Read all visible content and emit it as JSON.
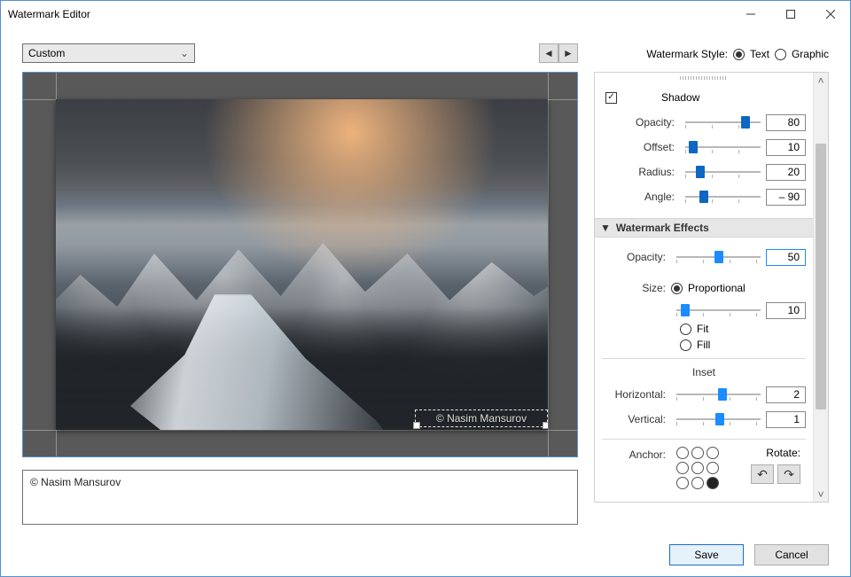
{
  "window": {
    "title": "Watermark Editor"
  },
  "preset": {
    "selected": "Custom"
  },
  "watermark_text_value": "© Nasim Mansurov",
  "watermark_overlay": "© Nasim Mansurov",
  "style_label": "Watermark Style:",
  "style_text": "Text",
  "style_graphic": "Graphic",
  "shadow": {
    "label": "Shadow",
    "opacity_label": "Opacity:",
    "opacity": 80,
    "offset_label": "Offset:",
    "offset": 10,
    "radius_label": "Radius:",
    "radius": 20,
    "angle_label": "Angle:",
    "angle": "– 90"
  },
  "effects": {
    "section": "Watermark Effects",
    "opacity_label": "Opacity:",
    "opacity": 50,
    "size_label": "Size:",
    "size_mode": "Proportional",
    "size_value": 10,
    "fit_label": "Fit",
    "fill_label": "Fill",
    "inset_label": "Inset",
    "horizontal_label": "Horizontal:",
    "horizontal": 2,
    "vertical_label": "Vertical:",
    "vertical": 1,
    "anchor_label": "Anchor:",
    "rotate_label": "Rotate:"
  },
  "footer": {
    "save": "Save",
    "cancel": "Cancel"
  }
}
